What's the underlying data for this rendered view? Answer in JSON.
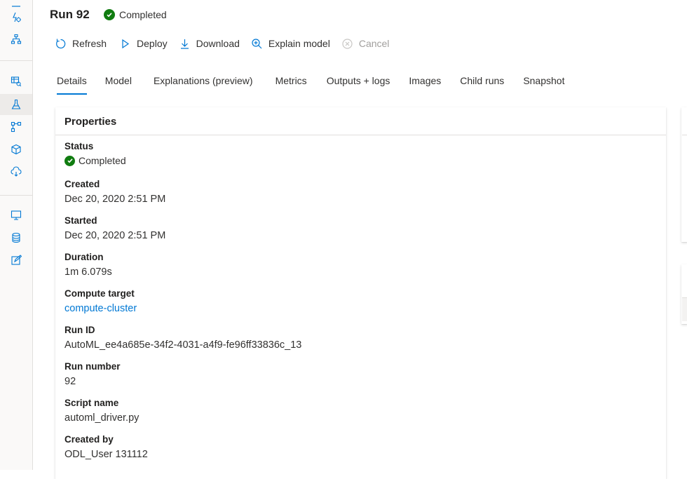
{
  "rail": {
    "items": [
      {
        "icon": "automl-icon"
      },
      {
        "icon": "designer-icon"
      },
      {
        "icon": "datasets-icon"
      },
      {
        "icon": "experiments-icon"
      },
      {
        "icon": "pipelines-icon"
      },
      {
        "icon": "models-icon"
      },
      {
        "icon": "endpoints-icon"
      },
      {
        "icon": "compute-icon"
      },
      {
        "icon": "datastores-icon"
      },
      {
        "icon": "data-labeling-icon"
      }
    ],
    "accent": "#0078d4"
  },
  "header": {
    "title": "Run 92",
    "status": "Completed",
    "status_color": "#107c10"
  },
  "toolbar": {
    "refresh": "Refresh",
    "deploy": "Deploy",
    "download": "Download",
    "explain": "Explain model",
    "cancel": "Cancel"
  },
  "tabs": [
    {
      "label": "Details",
      "active": true
    },
    {
      "label": "Model"
    },
    {
      "label": "Explanations (preview)"
    },
    {
      "label": "Metrics"
    },
    {
      "label": "Outputs + logs"
    },
    {
      "label": "Images"
    },
    {
      "label": "Child runs"
    },
    {
      "label": "Snapshot"
    }
  ],
  "properties": {
    "title": "Properties",
    "status": {
      "label": "Status",
      "value": "Completed"
    },
    "created": {
      "label": "Created",
      "value": "Dec 20, 2020 2:51 PM"
    },
    "started": {
      "label": "Started",
      "value": "Dec 20, 2020 2:51 PM"
    },
    "duration": {
      "label": "Duration",
      "value": "1m 6.079s"
    },
    "compute_target": {
      "label": "Compute target",
      "value": "compute-cluster"
    },
    "run_id": {
      "label": "Run ID",
      "value": "AutoML_ee4a685e-34f2-4031-a4f9-fe96ff33836c_13"
    },
    "run_number": {
      "label": "Run number",
      "value": "92"
    },
    "script_name": {
      "label": "Script name",
      "value": "automl_driver.py"
    },
    "created_by": {
      "label": "Created by",
      "value": "ODL_User 131112"
    }
  }
}
